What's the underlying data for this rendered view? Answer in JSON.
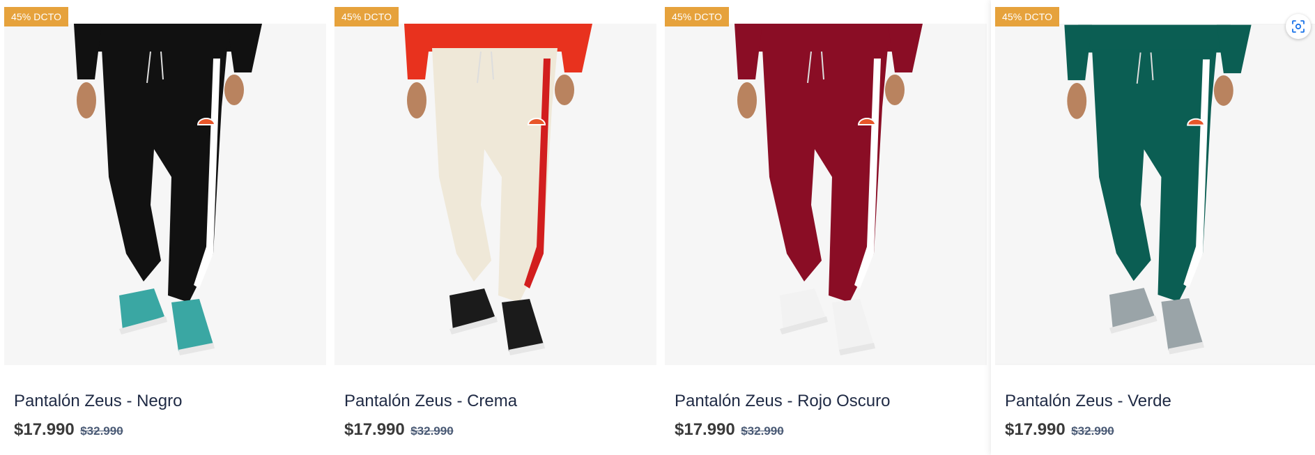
{
  "products": [
    {
      "badge": "45% DCTO",
      "title": "Pantalón Zeus - Negro",
      "price": "$17.990",
      "old_price": "$32.990",
      "image_icon": "black-jogger-pants-photo",
      "colors": {
        "pants": "#111111",
        "top": "#111111",
        "stripe": "#ffffff",
        "shoe": "#3aa7a3"
      }
    },
    {
      "badge": "45% DCTO",
      "title": "Pantalón Zeus - Crema",
      "price": "$17.990",
      "old_price": "$32.990",
      "image_icon": "cream-jogger-pants-photo",
      "colors": {
        "pants": "#efe8d8",
        "top": "#e8321e",
        "stripe": "#d21e1e",
        "shoe": "#1b1b1b"
      }
    },
    {
      "badge": "45% DCTO",
      "title": "Pantalón Zeus - Rojo Oscuro",
      "price": "$17.990",
      "old_price": "$32.990",
      "image_icon": "dark-red-jogger-pants-photo",
      "colors": {
        "pants": "#8a0d25",
        "top": "#8a0d25",
        "stripe": "#ffffff",
        "shoe": "#f2f2f2"
      }
    },
    {
      "badge": "45% DCTO",
      "title": "Pantalón Zeus - Verde",
      "price": "$17.990",
      "old_price": "$32.990",
      "image_icon": "green-jogger-pants-photo",
      "colors": {
        "pants": "#0b5e53",
        "top": "#0b5e53",
        "stripe": "#ffffff",
        "shoe": "#9aa4a8"
      }
    }
  ],
  "accent": "#e6a23c",
  "lens_icon": "visual-search-icon"
}
